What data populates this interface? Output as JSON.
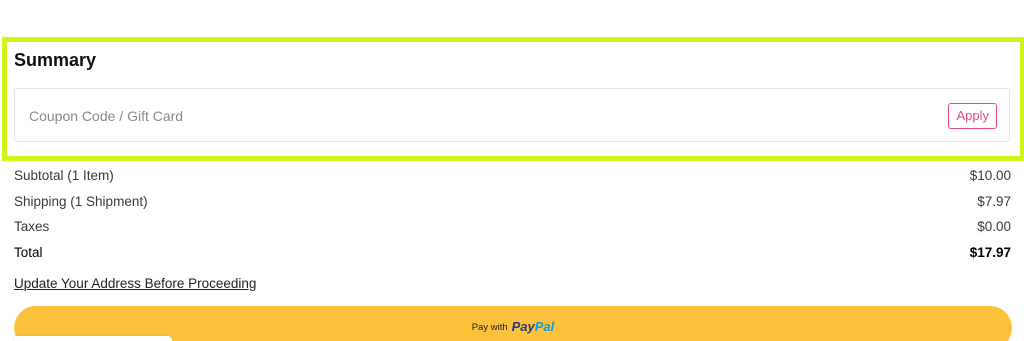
{
  "summary": {
    "title": "Summary",
    "coupon": {
      "placeholder": "Coupon Code / Gift Card",
      "value": "",
      "apply_label": "Apply"
    }
  },
  "totals": [
    {
      "label": "Subtotal (1 Item)",
      "value": "$10.00"
    },
    {
      "label": "Shipping (1 Shipment)",
      "value": "$7.97"
    },
    {
      "label": "Taxes",
      "value": "$0.00"
    },
    {
      "label": "Total",
      "value": "$17.97"
    }
  ],
  "update_address_link": "Update Your Address Before Proceeding",
  "paypal": {
    "prefix": "Pay with",
    "logo_pay": "Pay",
    "logo_pal": "Pal"
  },
  "colors": {
    "highlight": "#cef51a",
    "accent_pink": "#e64b86",
    "paypal_yellow": "#fcc23c",
    "paypal_dark_blue": "#253b80",
    "paypal_light_blue": "#179bd7"
  }
}
